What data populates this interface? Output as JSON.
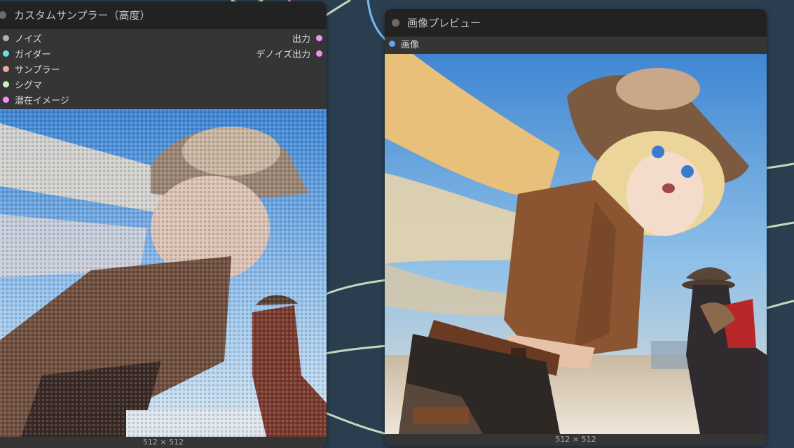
{
  "sampler_node": {
    "title": "カスタムサンプラー（高度）",
    "inputs": [
      {
        "label": "ノイズ",
        "color": "#b0b0b0"
      },
      {
        "label": "ガイダー",
        "color": "#66e0e0"
      },
      {
        "label": "サンプラー",
        "color": "#f0a898"
      },
      {
        "label": "シグマ",
        "color": "#c8f0b0"
      },
      {
        "label": "潜在イメージ",
        "color": "#f090f0"
      }
    ],
    "outputs": [
      {
        "label": "出力",
        "color": "#f090f0"
      },
      {
        "label": "デノイズ出力",
        "color": "#f090f0"
      }
    ],
    "image_size": "512 × 512"
  },
  "preview_node": {
    "title": "画像プレビュー",
    "inputs": [
      {
        "label": "画像",
        "color": "#5aa8f0"
      }
    ],
    "image_size": "512 × 512"
  },
  "colors": {
    "canvas_bg": "#2b3e50",
    "node_bg": "#353535",
    "node_title_bg": "#222222",
    "wire_color": "#c8d8c0",
    "image_wire_color": "#78b8f0"
  }
}
